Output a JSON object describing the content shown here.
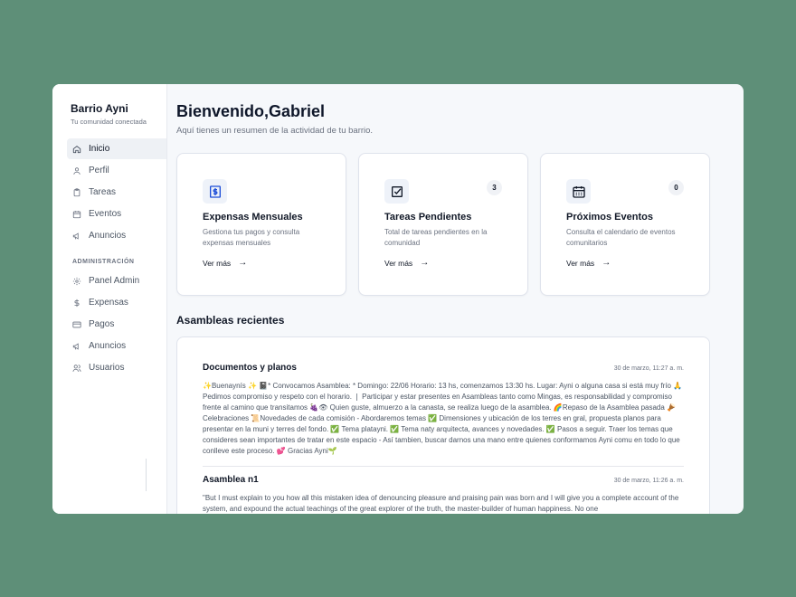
{
  "brand": {
    "title": "Barrio Ayni",
    "subtitle": "Tu comunidad conectada"
  },
  "nav": {
    "main_items": [
      {
        "label": "Inicio",
        "icon": "home-icon"
      },
      {
        "label": "Perfil",
        "icon": "user-icon"
      },
      {
        "label": "Tareas",
        "icon": "clipboard-icon"
      },
      {
        "label": "Eventos",
        "icon": "calendar-icon"
      },
      {
        "label": "Anuncios",
        "icon": "megaphone-icon"
      }
    ],
    "admin_label": "ADMINISTRACIÓN",
    "admin_items": [
      {
        "label": "Panel Admin",
        "icon": "gear-icon"
      },
      {
        "label": "Expensas",
        "icon": "dollar-icon"
      },
      {
        "label": "Pagos",
        "icon": "credit-card-icon"
      },
      {
        "label": "Anuncios",
        "icon": "megaphone-icon"
      },
      {
        "label": "Usuarios",
        "icon": "users-icon"
      }
    ]
  },
  "header": {
    "title": "Bienvenido,Gabriel",
    "subtitle": "Aquí tienes un resumen de la actividad de tu barrio."
  },
  "cards": [
    {
      "title": "Expensas Mensuales",
      "desc": "Gestiona tus pagos y consulta expensas mensuales",
      "link": "Ver más",
      "arrow": "→",
      "icon": "receipt-dollar-icon"
    },
    {
      "title": "Tareas Pendientes",
      "desc": "Total de tareas pendientes en la comunidad",
      "link": "Ver más",
      "arrow": "→",
      "badge": "3",
      "icon": "checkbox-icon"
    },
    {
      "title": "Próximos Eventos",
      "desc": "Consulta el calendario de eventos comunitarios",
      "link": "Ver más",
      "arrow": "→",
      "badge": "0",
      "icon": "calendar-icon"
    }
  ],
  "assemblies": {
    "title": "Asambleas recientes",
    "posts": [
      {
        "title": "Documentos y planos",
        "date": "30 de marzo, 11:27 a. m.",
        "body": "✨Buenaynís ✨ 📓* Convocamos Asamblea: * Domingo: 22/06 Horario: 13 hs, comenzamos 13:30 hs. Lugar: Ayni o alguna casa si está muy frío 🙏Pedimos compromiso y respeto con el horario. ❘ Participar y estar presentes en Asambleas tanto como Mingas, es responsabilidad y compromiso frente al camino que transitamos 🍇👁 Quien guste, almuerzo a la canasta, se realiza luego de la asamblea. 🌈Repaso de la Asamblea pasada 🪘Celebraciones 📜Novedades de cada comisión - Abordaremos temas ✅ Dimensiones y ubicación de los terres en gral, propuesta planos para presentar en la muni y terres del fondo. ✅ Tema platayni. ✅ Tema naty arquitecta, avances y novedades. ✅ Pasos a seguir. Traer los temas que consideres sean importantes de tratar en este espacio - Así tambien, buscar darnos una mano entre quienes conformamos Ayni comu en todo lo que conlleve este proceso. 💕 Gracias Ayni🌱"
      },
      {
        "title": "Asamblea n1",
        "date": "30 de marzo, 11:26 a. m.",
        "body": "\"But I must explain to you how all this mistaken idea of denouncing pleasure and praising pain was born and I will give you a complete account of the system, and expound the actual teachings of the great explorer of the truth, the master-builder of human happiness. No one"
      }
    ]
  },
  "colors": {
    "background": "#5e8f78",
    "accent_icon": "#1d4ed8"
  }
}
